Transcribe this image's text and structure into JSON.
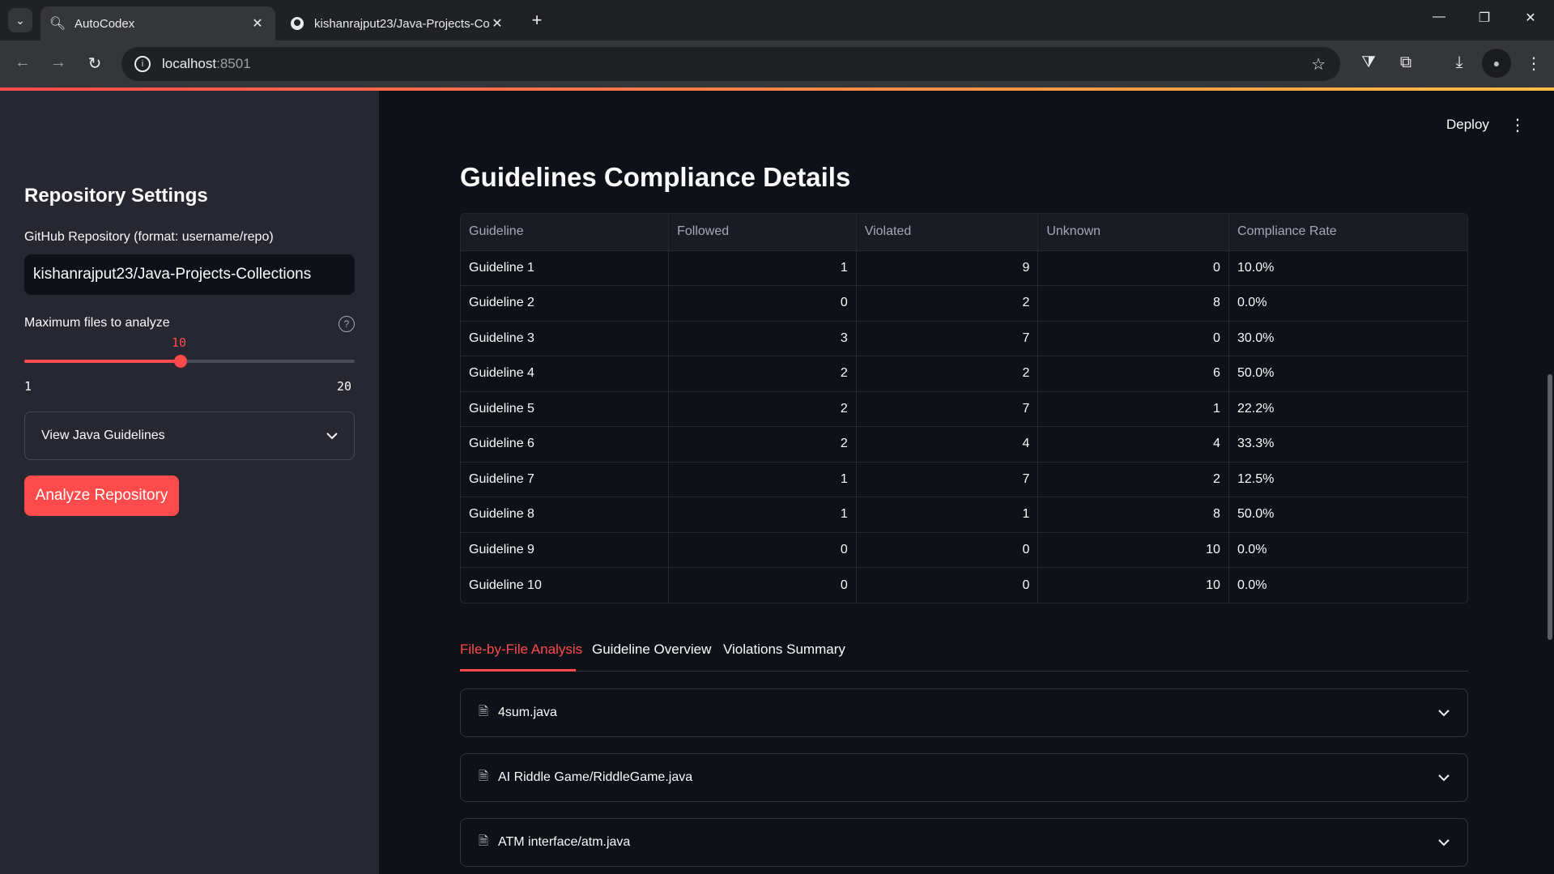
{
  "browser": {
    "tabs": [
      {
        "title": "AutoCodex",
        "icon": "search-icon"
      },
      {
        "title": "kishanrajput23/Java-Projects-Co",
        "icon": "github-icon"
      }
    ],
    "url_host": "localhost",
    "url_port": ":8501"
  },
  "sidebar": {
    "title": "Repository Settings",
    "repo_label": "GitHub Repository (format: username/repo)",
    "repo_value": "kishanrajput23/Java-Projects-Collections",
    "max_files_label": "Maximum files to analyze",
    "slider": {
      "value": "10",
      "min": "1",
      "max": "20",
      "fraction": 0.4737
    },
    "guidelines_expander": "View Java Guidelines",
    "analyze_button": "Analyze Repository"
  },
  "header": {
    "deploy": "Deploy"
  },
  "main": {
    "title": "Guidelines Compliance Details",
    "table": {
      "columns": [
        "Guideline",
        "Followed",
        "Violated",
        "Unknown",
        "Compliance Rate"
      ],
      "rows": [
        [
          "Guideline 1",
          "1",
          "9",
          "0",
          "10.0%"
        ],
        [
          "Guideline 2",
          "0",
          "2",
          "8",
          "0.0%"
        ],
        [
          "Guideline 3",
          "3",
          "7",
          "0",
          "30.0%"
        ],
        [
          "Guideline 4",
          "2",
          "2",
          "6",
          "50.0%"
        ],
        [
          "Guideline 5",
          "2",
          "7",
          "1",
          "22.2%"
        ],
        [
          "Guideline 6",
          "2",
          "4",
          "4",
          "33.3%"
        ],
        [
          "Guideline 7",
          "1",
          "7",
          "2",
          "12.5%"
        ],
        [
          "Guideline 8",
          "1",
          "1",
          "8",
          "50.0%"
        ],
        [
          "Guideline 9",
          "0",
          "0",
          "10",
          "0.0%"
        ],
        [
          "Guideline 10",
          "0",
          "0",
          "10",
          "0.0%"
        ]
      ]
    },
    "tabs": [
      "File-by-File Analysis",
      "Guideline Overview",
      "Violations Summary"
    ],
    "files": [
      "4sum.java",
      "AI Riddle Game/RiddleGame.java",
      "ATM interface/atm.java"
    ]
  },
  "colors": {
    "accent": "#ff4b4b",
    "sidebar_bg": "#262730",
    "main_bg": "#0e1117"
  }
}
